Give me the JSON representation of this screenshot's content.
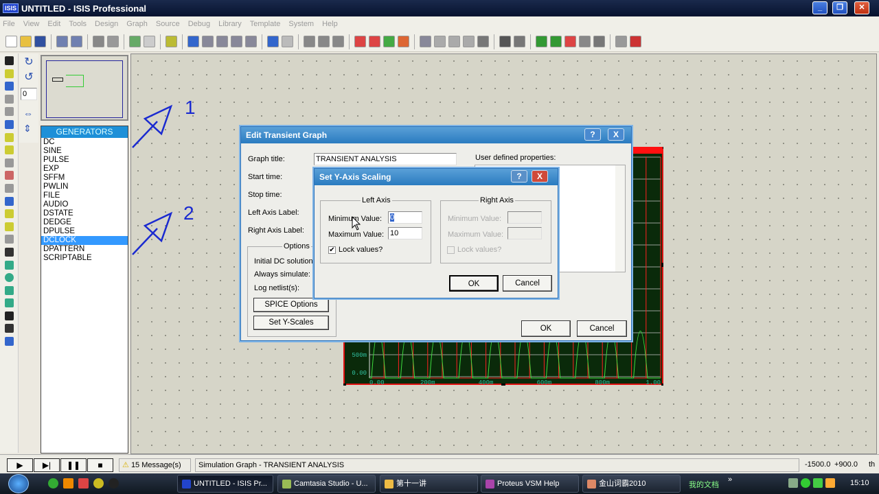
{
  "window": {
    "title": "UNTITLED - ISIS Professional",
    "logo": "ISIS",
    "minimize": "_",
    "maximize": "❐",
    "close": "✕"
  },
  "menu": [
    "File",
    "View",
    "Edit",
    "Tools",
    "Design",
    "Graph",
    "Source",
    "Debug",
    "Library",
    "Template",
    "System",
    "Help"
  ],
  "toolbar_icons": [
    "new-file",
    "open-folder",
    "save",
    "import",
    "export",
    "print",
    "print-area",
    "refresh",
    "grid",
    "origin",
    "pan",
    "zoom-in",
    "zoom-out",
    "zoom-all",
    "zoom-area",
    "undo",
    "redo",
    "cut",
    "copy",
    "paste",
    "block-copy",
    "block-move",
    "block-rotate",
    "block-delete",
    "pick-device",
    "make-device",
    "packaging",
    "decompose",
    "wire-autorouter",
    "search-tag",
    "property-assign",
    "new-sheet",
    "remove-sheet",
    "goto-sheet",
    "bill-of-materials",
    "electrical-check",
    "netlist",
    "ares"
  ],
  "left_tools": [
    "selection",
    "component",
    "junction",
    "wire-label",
    "text-script",
    "bus",
    "subcircuit",
    "terminals",
    "device-pins",
    "graph",
    "tape-recorder",
    "generator",
    "voltage-probe",
    "current-probe",
    "virtual-instruments",
    "line",
    "box",
    "circle",
    "arc",
    "path",
    "text",
    "symbol",
    "marker"
  ],
  "orientation": {
    "angle": "0",
    "rotate_cw": "rotate-cw",
    "rotate_ccw": "rotate-ccw",
    "mirror_x": "mirror-horizontal",
    "mirror_y": "mirror-vertical"
  },
  "component_list": {
    "header": "GENERATORS",
    "items": [
      "DC",
      "SINE",
      "PULSE",
      "EXP",
      "SFFM",
      "PWLIN",
      "FILE",
      "AUDIO",
      "DSTATE",
      "DEDGE",
      "DPULSE",
      "DCLOCK",
      "DPATTERN",
      "SCRIPTABLE"
    ],
    "selected": "DCLOCK"
  },
  "annotations": {
    "label1": "1",
    "label2": "2",
    "arrow_color": "#1a2ad0"
  },
  "graph": {
    "y_ticks": [
      "500m",
      "0.00"
    ],
    "x_ticks": [
      "0.00",
      "200m",
      "400m",
      "600m",
      "800m",
      "1.00"
    ],
    "background": "#0a2a0a",
    "border": "#ff0000",
    "trace": "#40e040"
  },
  "edit_dialog": {
    "title": "Edit Transient Graph",
    "help": "?",
    "close": "X",
    "graph_title_label": "Graph title:",
    "graph_title_value": "TRANSIENT ANALYSIS",
    "start_time_label": "Start time:",
    "stop_time_label": "Stop time:",
    "left_axis_label": "Left Axis Label:",
    "right_axis_label": "Right Axis Label:",
    "user_props_label": "User defined properties:",
    "options_title": "Options",
    "initial_dc": "Initial DC solution:",
    "always_sim": "Always simulate:",
    "log_netlist": "Log netlist(s):",
    "spice_button": "SPICE Options",
    "yscales_button": "Set Y-Scales",
    "ok": "OK",
    "cancel": "Cancel"
  },
  "yaxis_dialog": {
    "title": "Set Y-Axis Scaling",
    "help": "?",
    "close": "X",
    "left_title": "Left Axis",
    "right_title": "Right Axis",
    "min_label": "Minimum Value:",
    "max_label": "Maximum Value:",
    "left_min": "0",
    "left_max": "10",
    "lock_label": "Lock values?",
    "left_lock": true,
    "right_lock": false,
    "ok": "OK",
    "cancel": "Cancel"
  },
  "status": {
    "messages": "15 Message(s)",
    "text": "Simulation Graph - TRANSIENT ANALYSIS",
    "coord_x": "-1500.0",
    "coord_y": "+900.0",
    "units": "th"
  },
  "taskbar": {
    "tasks": [
      {
        "label": "UNTITLED - ISIS Pr...",
        "active": true
      },
      {
        "label": "Camtasia Studio - U..."
      },
      {
        "label": "第十一讲"
      },
      {
        "label": "Proteus VSM Help"
      },
      {
        "label": "金山词霸2010"
      }
    ],
    "toolbar_label": "我的文档",
    "more": "»",
    "clock": "15:10"
  }
}
